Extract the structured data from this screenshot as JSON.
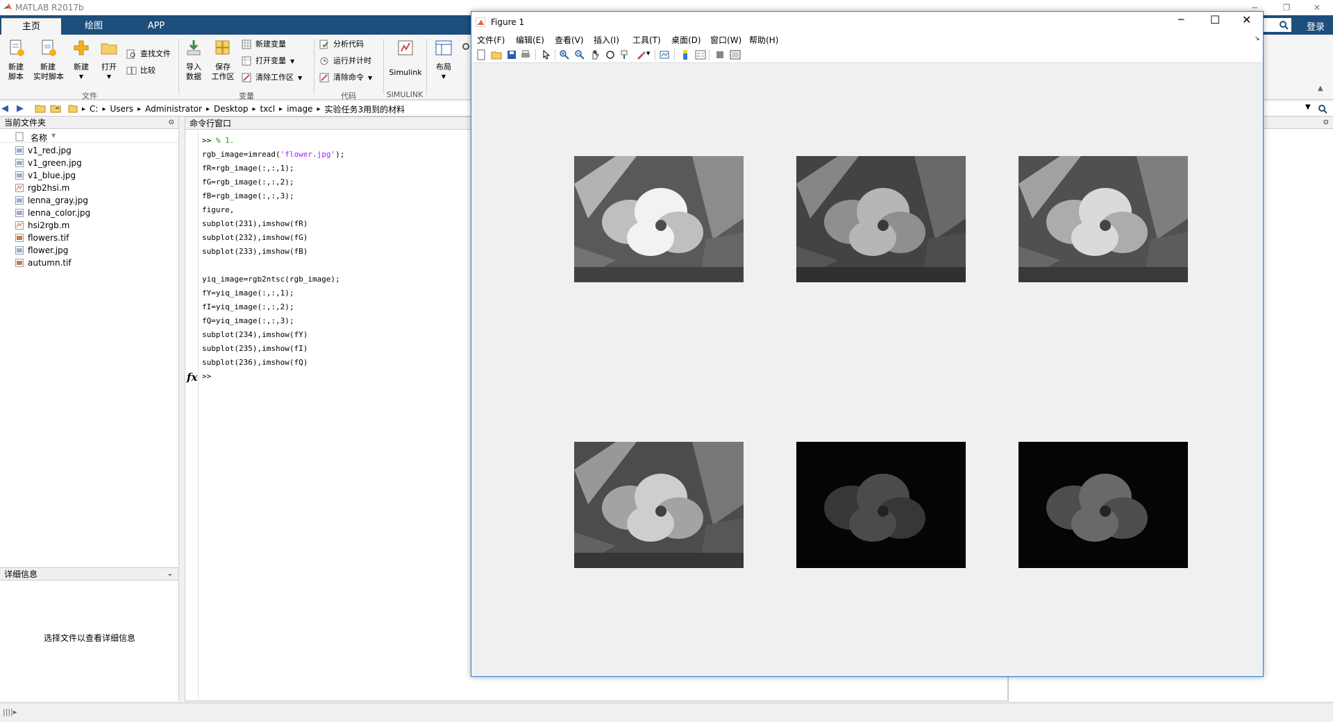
{
  "app": {
    "title": "MATLAB R2017b",
    "login_label": "登录"
  },
  "tabs": [
    {
      "label": "主页"
    },
    {
      "label": "绘图"
    },
    {
      "label": "APP"
    }
  ],
  "ribbon": {
    "new_script": "新建\n脚本",
    "new_live": "新建\n实时脚本",
    "new": "新建",
    "open": "打开",
    "find_files": "查找文件",
    "compare": "比较",
    "import": "导入\n数据",
    "save_ws": "保存\n工作区",
    "new_var": "新建变量",
    "open_var": "打开变量",
    "clear_ws": "清除工作区",
    "analyze": "分析代码",
    "run_time": "运行并计时",
    "clear_cmd": "清除命令",
    "simulink": "Simulink",
    "layout": "布局",
    "groups": {
      "file": "文件",
      "variable": "变量",
      "code": "代码",
      "simulink": "SIMULINK"
    }
  },
  "address": {
    "crumbs": [
      "C:",
      "Users",
      "Administrator",
      "Desktop",
      "txcl",
      "image",
      "实验任务3用到的材料"
    ]
  },
  "file_panel": {
    "title": "当前文件夹",
    "column": "名称",
    "files": [
      {
        "name": "v1_red.jpg",
        "kind": "image"
      },
      {
        "name": "v1_green.jpg",
        "kind": "image"
      },
      {
        "name": "v1_blue.jpg",
        "kind": "image"
      },
      {
        "name": "rgb2hsi.m",
        "kind": "script"
      },
      {
        "name": "lenna_gray.jpg",
        "kind": "image"
      },
      {
        "name": "lenna_color.jpg",
        "kind": "image"
      },
      {
        "name": "hsi2rgb.m",
        "kind": "script"
      },
      {
        "name": "flowers.tif",
        "kind": "tif"
      },
      {
        "name": "flower.jpg",
        "kind": "image"
      },
      {
        "name": "autumn.tif",
        "kind": "tif"
      }
    ]
  },
  "detail_panel": {
    "title": "详细信息",
    "message": "选择文件以查看详细信息"
  },
  "command_window": {
    "title": "命令行窗口",
    "line1_prompt": ">> ",
    "line1_comment": "% 1.",
    "line2_pre": "rgb_image=imread(",
    "line2_str": "'flower.jpg'",
    "line2_post": ");",
    "lines_a": [
      "fR=rgb_image(:,:,1);",
      "fG=rgb_image(:,:,2);",
      "fB=rgb_image(:,:,3);",
      "figure,",
      "subplot(231),imshow(fR)",
      "subplot(232),imshow(fG)",
      "subplot(233),imshow(fB)"
    ],
    "lines_b": [
      "yiq_image=rgb2ntsc(rgb_image);",
      "fY=yiq_image(:,:,1);",
      "fI=yiq_image(:,:,2);",
      "fQ=yiq_image(:,:,3);",
      "subplot(234),imshow(fY)",
      "subplot(235),imshow(fI)",
      "subplot(236),imshow(fQ)"
    ],
    "fx_label": "fx",
    "prompt": ">>"
  },
  "figure": {
    "title": "Figure 1",
    "menu": [
      "文件(F)",
      "编辑(E)",
      "查看(V)",
      "插入(I)",
      "工具(T)",
      "桌面(D)",
      "窗口(W)",
      "帮助(H)"
    ],
    "subplots": [
      {
        "name": "fR",
        "brightness": 1.0
      },
      {
        "name": "fG",
        "brightness": 0.75
      },
      {
        "name": "fB",
        "brightness": 0.9
      },
      {
        "name": "fY",
        "brightness": 0.85
      },
      {
        "name": "fI",
        "brightness": 0.25
      },
      {
        "name": "fQ",
        "brightness": 0.35
      }
    ]
  },
  "colors": {
    "tabbar": "#1e4e7c",
    "window_border": "#2c7fcf"
  }
}
